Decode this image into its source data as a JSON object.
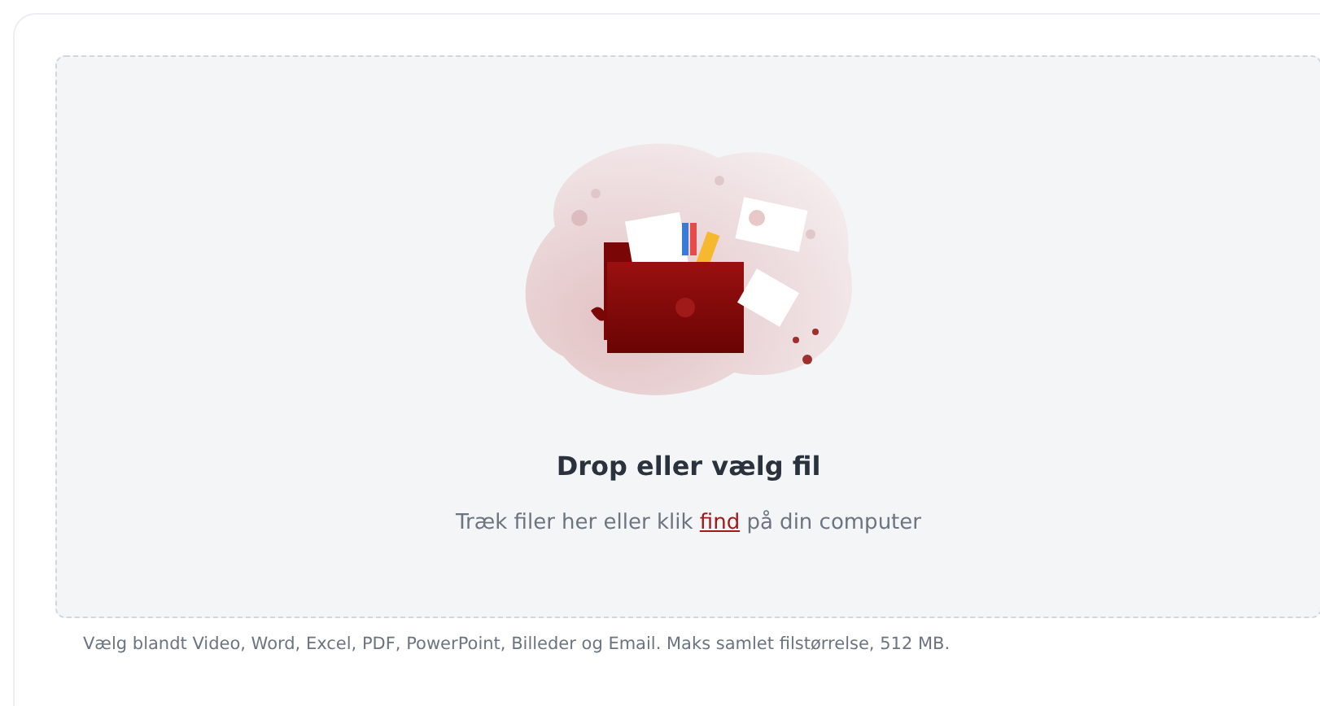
{
  "dropzone": {
    "title": "Drop eller vælg fil",
    "prompt": {
      "before": "Træk filer her eller klik ",
      "link": "find",
      "after": " på din computer"
    }
  },
  "footnote": "Vælg blandt Video, Word, Excel, PDF, PowerPoint, Billeder og Email. Maks samlet filstørrelse, 512 MB."
}
